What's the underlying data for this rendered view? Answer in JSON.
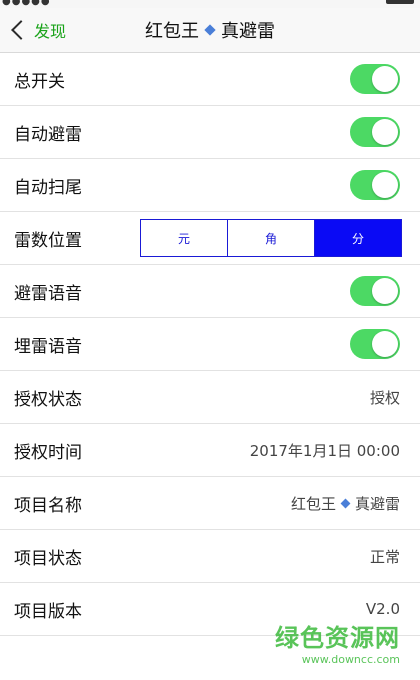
{
  "colors": {
    "accent": "#1aa31a",
    "switch_on": "#4cd964",
    "segment": "#0a0af5"
  },
  "nav": {
    "back_label": "发现",
    "title_part1": "红包王",
    "title_part2": "真避雷"
  },
  "rows": {
    "master_switch": {
      "label": "总开关",
      "on": true
    },
    "auto_avoid": {
      "label": "自动避雷",
      "on": true
    },
    "auto_tail": {
      "label": "自动扫尾",
      "on": true
    },
    "mine_position": {
      "label": "雷数位置",
      "options": [
        "元",
        "角",
        "分"
      ],
      "selected": "分"
    },
    "avoid_voice": {
      "label": "避雷语音",
      "on": true
    },
    "bury_voice": {
      "label": "埋雷语音",
      "on": true
    },
    "auth_status": {
      "label": "授权状态",
      "value": "授权"
    },
    "auth_time": {
      "label": "授权时间",
      "value": "2017年1月1日 00:00"
    },
    "project_name": {
      "label": "项目名称",
      "value_part1": "红包王",
      "value_part2": "真避雷"
    },
    "project_status": {
      "label": "项目状态",
      "value": "正常"
    },
    "project_version": {
      "label": "项目版本",
      "value": "V2.0"
    }
  },
  "watermark": {
    "main": "绿色资源网",
    "url": "www.downcc.com"
  }
}
